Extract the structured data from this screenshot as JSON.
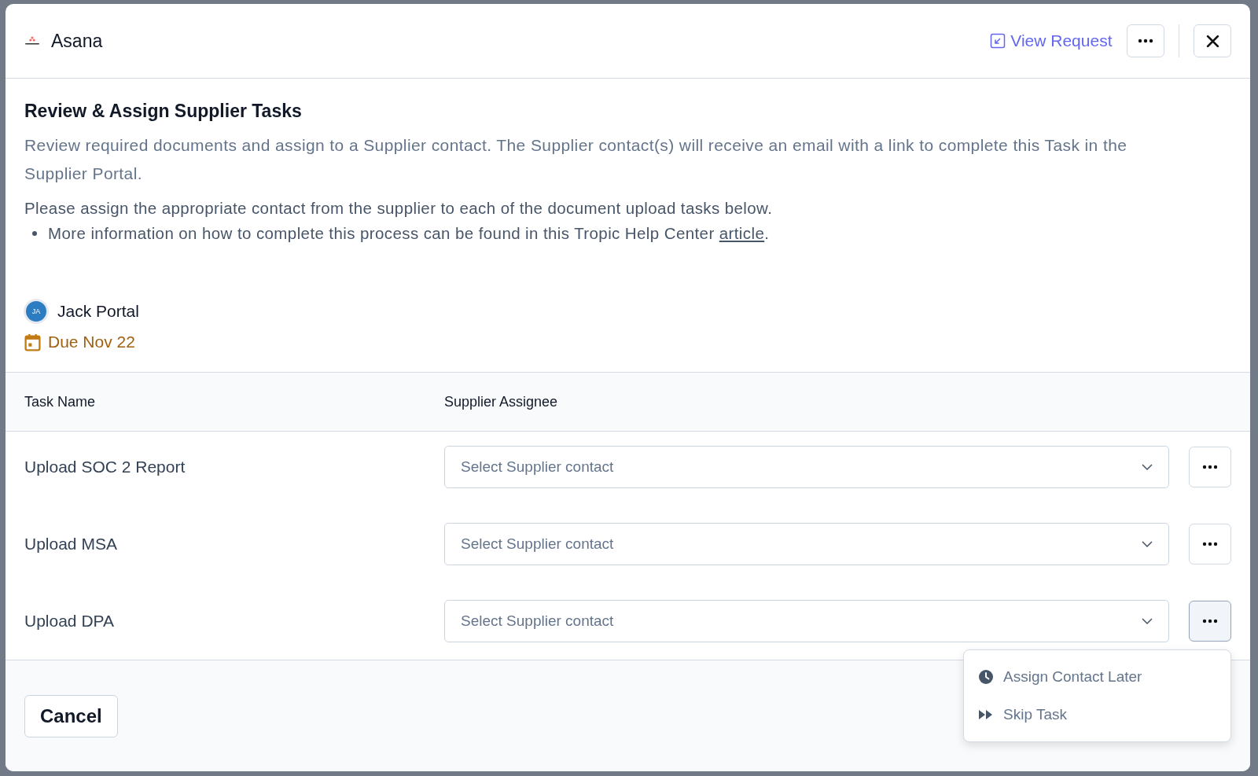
{
  "header": {
    "app_name": "Asana",
    "view_request": "View Request"
  },
  "title": "Review & Assign Supplier Tasks",
  "description": "Review required documents and assign to a Supplier contact. The Supplier contact(s) will receive an email with a link to complete this Task in the Supplier Portal.",
  "instructions": "Please assign the appropriate contact from the supplier to each of the document upload tasks below.",
  "bullet": {
    "text": "More information on how to complete this process can be found in this Tropic Help Center",
    "link": "article",
    "end": "."
  },
  "assignee": {
    "initials": "JA",
    "name": "Jack Portal"
  },
  "due": "Due Nov 22",
  "table": {
    "columns": [
      "Task Name",
      "Supplier Assignee"
    ],
    "rows": [
      {
        "task": "Upload SOC 2 Report",
        "placeholder": "Select Supplier contact",
        "menu_open": false
      },
      {
        "task": "Upload MSA",
        "placeholder": "Select Supplier contact",
        "menu_open": false
      },
      {
        "task": "Upload DPA",
        "placeholder": "Select Supplier contact",
        "menu_open": true
      }
    ]
  },
  "menu": [
    {
      "kind": "clock",
      "label": "Assign Contact Later"
    },
    {
      "kind": "skip",
      "label": "Skip Task"
    }
  ],
  "footer": {
    "cancel": "Cancel"
  }
}
